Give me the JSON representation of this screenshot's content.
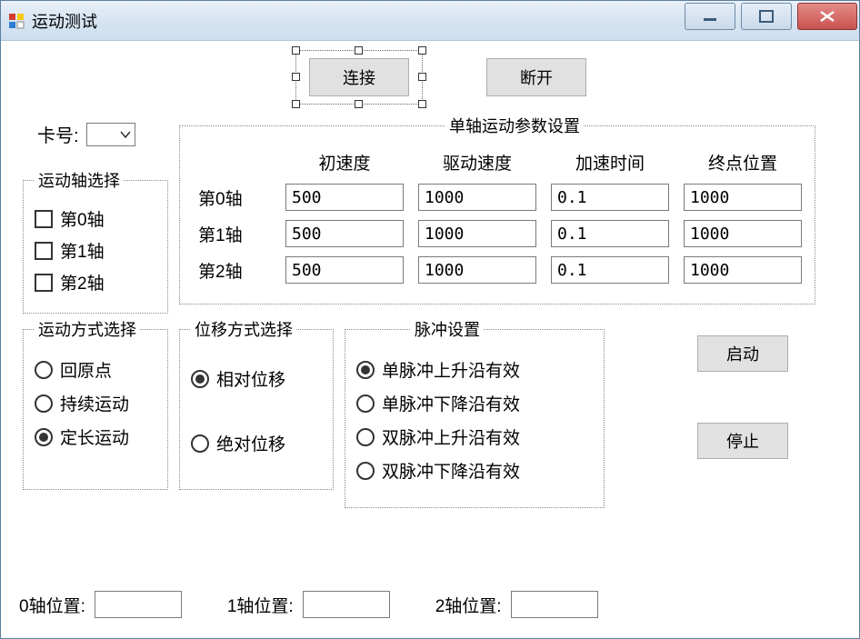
{
  "window": {
    "title": "运动测试"
  },
  "buttons": {
    "connect": "连接",
    "disconnect": "断开",
    "start": "启动",
    "stop": "停止"
  },
  "card": {
    "label": "卡号:",
    "value": ""
  },
  "axis_select": {
    "legend": "运动轴选择",
    "items": [
      "第0轴",
      "第1轴",
      "第2轴"
    ],
    "checked": [
      false,
      false,
      false
    ]
  },
  "params": {
    "legend": "单轴运动参数设置",
    "headers": [
      "初速度",
      "驱动速度",
      "加速时间",
      "终点位置"
    ],
    "rows": [
      {
        "label": "第0轴",
        "values": [
          "500",
          "1000",
          "0.1",
          "1000"
        ]
      },
      {
        "label": "第1轴",
        "values": [
          "500",
          "1000",
          "0.1",
          "1000"
        ]
      },
      {
        "label": "第2轴",
        "values": [
          "500",
          "1000",
          "0.1",
          "1000"
        ]
      }
    ]
  },
  "move_mode": {
    "legend": "运动方式选择",
    "options": [
      "回原点",
      "持续运动",
      "定长运动"
    ],
    "selected": 2
  },
  "disp_mode": {
    "legend": "位移方式选择",
    "options": [
      "相对位移",
      "绝对位移"
    ],
    "selected": 0
  },
  "pulse": {
    "legend": "脉冲设置",
    "options": [
      "单脉冲上升沿有效",
      "单脉冲下降沿有效",
      "双脉冲上升沿有效",
      "双脉冲下降沿有效"
    ],
    "selected": 0
  },
  "position": {
    "labels": [
      "0轴位置:",
      "1轴位置:",
      "2轴位置:"
    ],
    "values": [
      "",
      "",
      ""
    ]
  }
}
